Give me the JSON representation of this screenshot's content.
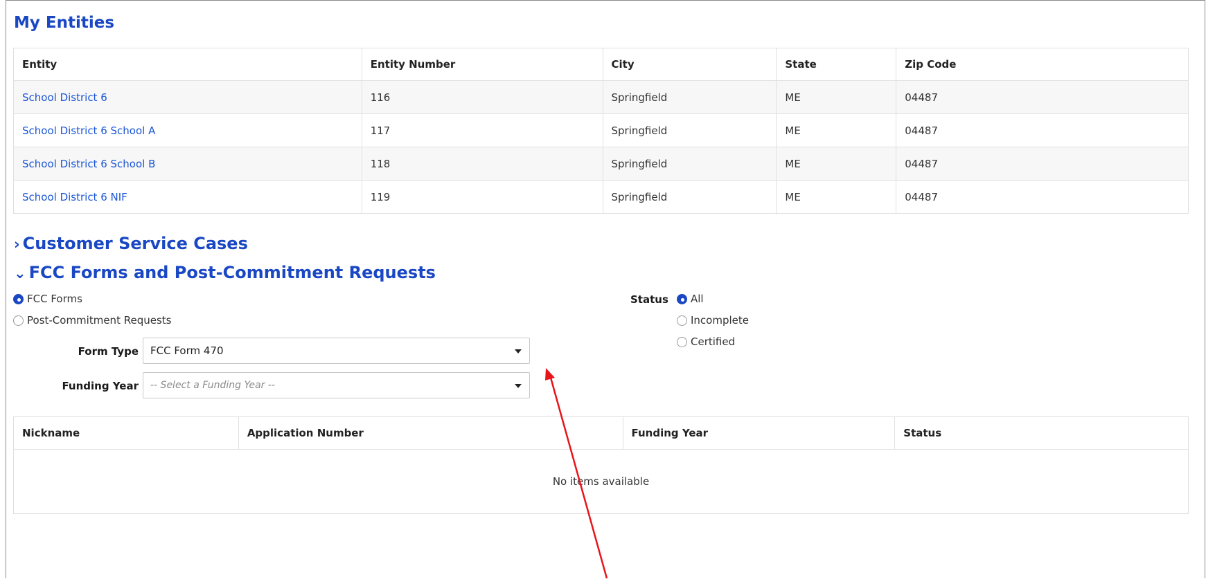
{
  "entities": {
    "title": "My Entities",
    "columns": [
      "Entity",
      "Entity Number",
      "City",
      "State",
      "Zip Code"
    ],
    "rows": [
      {
        "entity": "School District 6",
        "number": "116",
        "city": "Springfield",
        "state": "ME",
        "zip": "04487"
      },
      {
        "entity": "School District 6 School A",
        "number": "117",
        "city": "Springfield",
        "state": "ME",
        "zip": "04487"
      },
      {
        "entity": "School District 6 School B",
        "number": "118",
        "city": "Springfield",
        "state": "ME",
        "zip": "04487"
      },
      {
        "entity": "School District 6 NIF",
        "number": "119",
        "city": "Springfield",
        "state": "ME",
        "zip": "04487"
      }
    ]
  },
  "cases": {
    "title": "Customer Service Cases",
    "chevron": "chevron-right-icon"
  },
  "forms": {
    "title": "FCC Forms and Post-Commitment Requests",
    "chevron": "chevron-down-icon",
    "mode_options": [
      {
        "label": "FCC Forms",
        "selected": true
      },
      {
        "label": "Post-Commitment Requests",
        "selected": false
      }
    ],
    "status_label": "Status",
    "status_options": [
      {
        "label": "All",
        "selected": true
      },
      {
        "label": "Incomplete",
        "selected": false
      },
      {
        "label": "Certified",
        "selected": false
      }
    ],
    "form_type_label": "Form Type",
    "form_type_value": "FCC Form 470",
    "funding_year_label": "Funding Year",
    "funding_year_placeholder": "-- Select a Funding Year --",
    "columns": [
      "Nickname",
      "Application Number",
      "Funding Year",
      "Status"
    ],
    "empty_text": "No items available"
  },
  "colors": {
    "heading": "#1a47c4",
    "link": "#1a55d6",
    "annotation_arrow": "#e8141a"
  }
}
